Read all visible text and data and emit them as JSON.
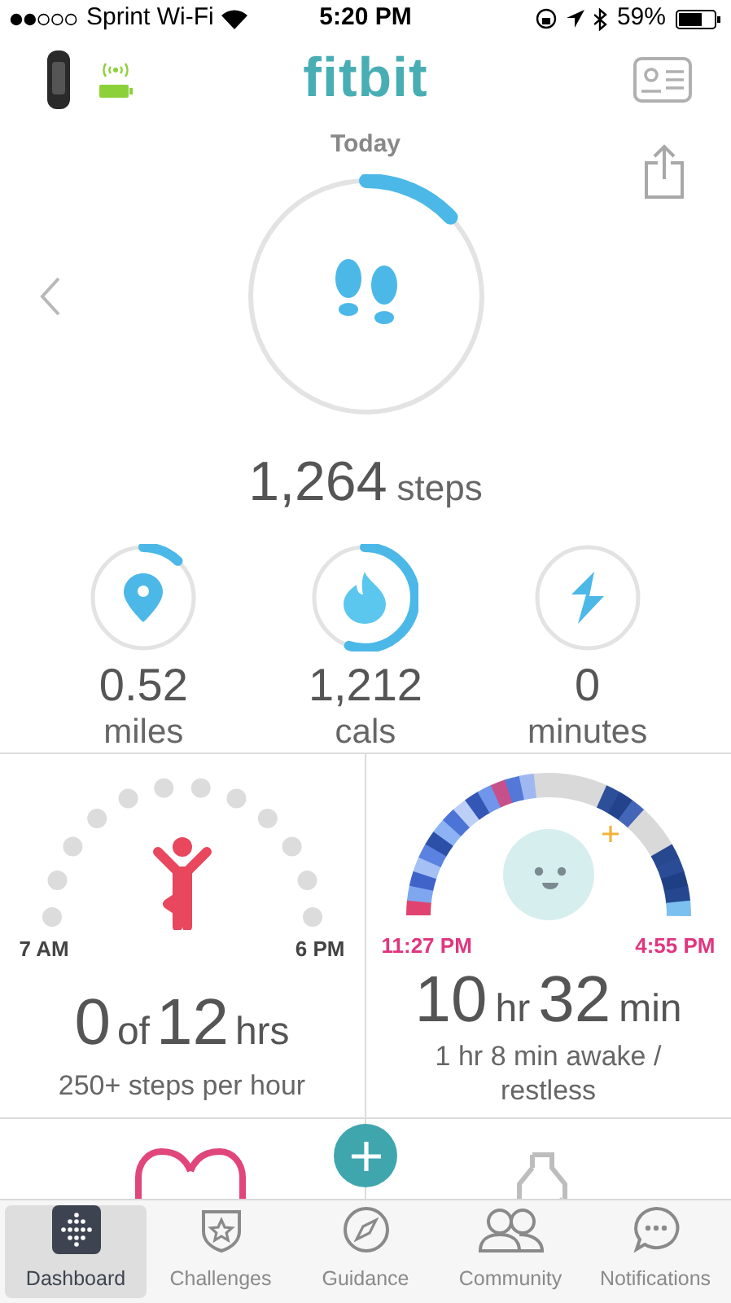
{
  "status_bar": {
    "carrier": "Sprint Wi-Fi",
    "time": "5:20 PM",
    "battery": "59%"
  },
  "header": {
    "logo": "fitbit"
  },
  "date": "Today",
  "steps": {
    "value": "1,264",
    "unit": "steps"
  },
  "stats": [
    {
      "kind": "distance",
      "value": "0.52",
      "unit": "miles"
    },
    {
      "kind": "calories",
      "value": "1,212",
      "unit": "cals"
    },
    {
      "kind": "active",
      "value": "0",
      "unit": "minutes"
    }
  ],
  "hourly": {
    "start": "7 AM",
    "end": "6 PM",
    "value": "0",
    "of": "of",
    "goal": "12",
    "unit": "hrs",
    "caption": "250+ steps per hour",
    "hours": [
      {
        "active": false
      },
      {
        "active": false
      },
      {
        "active": false
      },
      {
        "active": false
      },
      {
        "active": false
      },
      {
        "active": false
      },
      {
        "active": false
      },
      {
        "active": false
      },
      {
        "active": false
      },
      {
        "active": false
      },
      {
        "active": false
      },
      {
        "active": false
      }
    ]
  },
  "sleep": {
    "start": "11:27 PM",
    "end": "4:55 PM",
    "hours": "10",
    "hours_unit": "hr",
    "minutes": "32",
    "minutes_unit": "min",
    "caption": "1 hr 8 min awake / restless"
  },
  "tabs": [
    {
      "kind": "dashboard",
      "label": "Dashboard",
      "selected": true
    },
    {
      "kind": "challenges",
      "label": "Challenges",
      "selected": false
    },
    {
      "kind": "guidance",
      "label": "Guidance",
      "selected": false
    },
    {
      "kind": "community",
      "label": "Community",
      "selected": false
    },
    {
      "kind": "notifications",
      "label": "Notifications",
      "selected": false
    }
  ]
}
